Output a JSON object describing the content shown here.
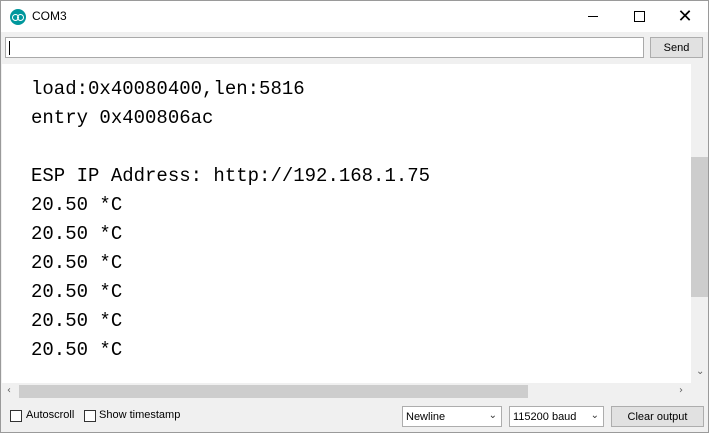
{
  "window": {
    "title": "COM3",
    "accent_color": "#00979c"
  },
  "input": {
    "value": "",
    "send_label": "Send"
  },
  "output": {
    "lines": [
      "load:0x40080400,len:5816",
      "entry 0x400806ac",
      "",
      "ESP IP Address: http://192.168.1.75",
      "20.50 *C",
      "20.50 *C",
      "20.50 *C",
      "20.50 *C",
      "20.50 *C",
      "20.50 *C"
    ]
  },
  "footer": {
    "autoscroll_label": "Autoscroll",
    "autoscroll_checked": false,
    "timestamp_label": "Show timestamp",
    "timestamp_checked": false,
    "line_ending_selected": "Newline",
    "baud_selected": "115200 baud",
    "clear_label": "Clear output"
  },
  "icons": {
    "app": "arduino-logo-icon",
    "minimize": "minimize-icon",
    "maximize": "maximize-icon",
    "close": "close-icon"
  }
}
